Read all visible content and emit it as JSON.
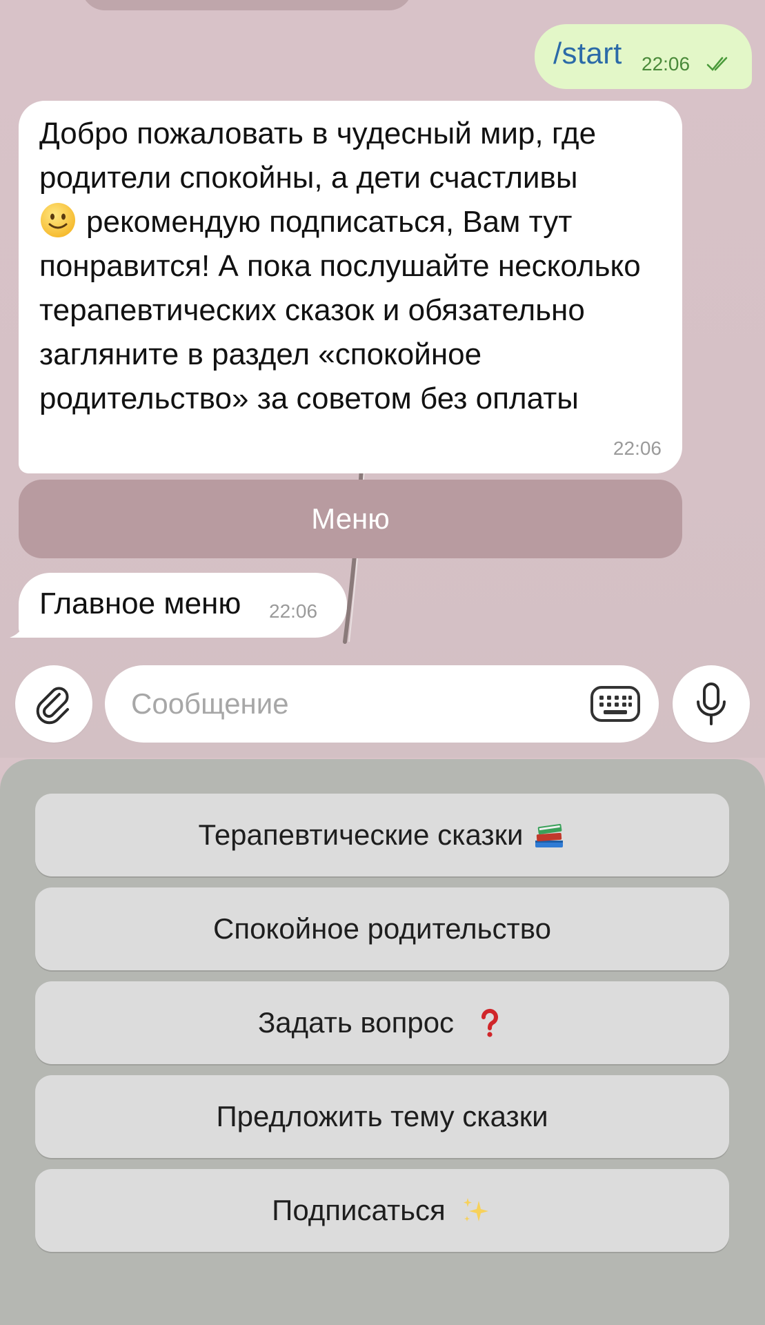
{
  "chat": {
    "outgoing": {
      "command": "/start",
      "time": "22:06"
    },
    "welcome": {
      "text_part1": "Добро пожаловать в чудесный мир, где родители спокойны, а дети счастливы",
      "text_part2": "рекомендую подписаться, Вам тут понравится! А пока послушайте несколько терапевтических сказок и обязательно загляните в раздел «спокойное родительство» за советом без оплаты",
      "time": "22:06"
    },
    "inline_button": {
      "label": "Меню"
    },
    "main_menu": {
      "text": "Главное меню",
      "time": "22:06"
    }
  },
  "composer": {
    "placeholder": "Сообщение"
  },
  "keyboard": {
    "buttons": [
      {
        "label": "Терапевтические сказки",
        "emoji": "books-icon"
      },
      {
        "label": "Спокойное родительство",
        "emoji": ""
      },
      {
        "label": "Задать вопрос",
        "emoji": "question-mark-icon"
      },
      {
        "label": "Предложить тему сказки",
        "emoji": ""
      },
      {
        "label": "Подписаться",
        "emoji": "sparkles-icon"
      }
    ]
  },
  "colors": {
    "chat_bg": "#d8c2c8",
    "outgoing_bubble": "#e3f7c8",
    "incoming_bubble": "#ffffff",
    "inline_button": "#b89ba0",
    "keyboard_bg": "#b5b7b2",
    "keyboard_button": "#dcdcdc",
    "link_blue": "#2b6aa8"
  }
}
